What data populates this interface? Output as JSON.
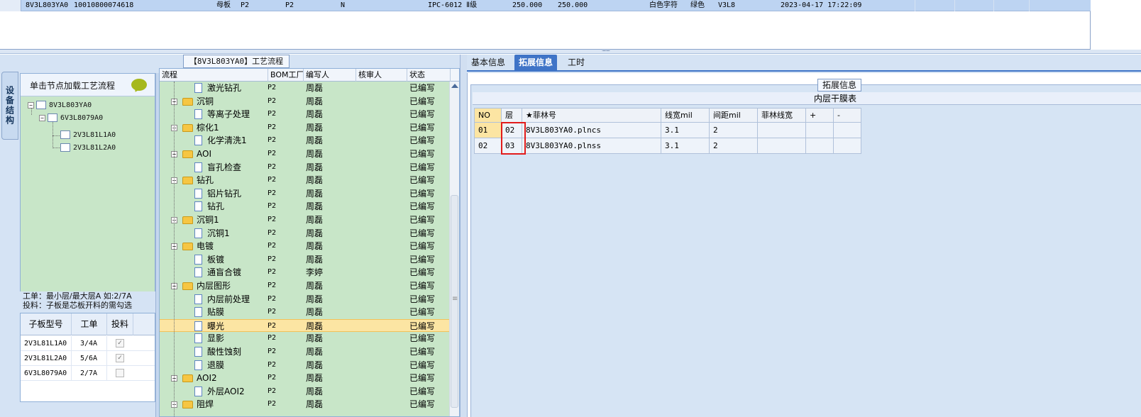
{
  "top_grid": {
    "row": {
      "code": "8V3L803YA0",
      "number": "10010800074618",
      "type": "母板",
      "f1": "P2",
      "f2": "P2",
      "f3": "N",
      "model": "IPC-6012 Ⅱ级",
      "v1": "250.000",
      "v2": "250.000",
      "text_color": "白色字符",
      "solder_color": "绿色",
      "version": "V3L8",
      "datetime": "2023-04-17 17:22:09"
    }
  },
  "splitter_grip": "·········",
  "left": {
    "title": "【8V3L803YA0】工艺流程",
    "side_tab": "设备结构",
    "load_label": "单击节点加载工艺流程",
    "tree": {
      "root": "8V3L803YA0",
      "child": "6V3L8079A0",
      "leaves": [
        "2V3L81L1A0",
        "2V3L81L2A0"
      ]
    },
    "info_line1": "工单：最小层/最大层A 如:2/7A",
    "info_line2": "投料：子板是芯板开料的需勾选",
    "sub_table": {
      "headers": [
        "子板型号",
        "工单",
        "投料"
      ],
      "rows": [
        {
          "model": "2V3L81L1A0",
          "order": "3/4A",
          "checked": true
        },
        {
          "model": "2V3L81L2A0",
          "order": "5/6A",
          "checked": true
        },
        {
          "model": "6V3L8079A0",
          "order": "2/7A",
          "checked": false
        }
      ]
    }
  },
  "flow": {
    "headers": [
      "流程",
      "BOM工厂",
      "编写人",
      "核审人",
      "状态"
    ],
    "rows": [
      {
        "name": "激光钻孔",
        "level": 2,
        "bom": "P2",
        "writer": "周磊",
        "reviewer": "",
        "status": "已编写"
      },
      {
        "name": "沉铜",
        "level": 1,
        "bom": "P2",
        "writer": "周磊",
        "reviewer": "",
        "status": "已编写"
      },
      {
        "name": "等离子处理",
        "level": 2,
        "bom": "P2",
        "writer": "周磊",
        "reviewer": "",
        "status": "已编写"
      },
      {
        "name": "棕化1",
        "level": 1,
        "bom": "P2",
        "writer": "周磊",
        "reviewer": "",
        "status": "已编写"
      },
      {
        "name": "化学清洗1",
        "level": 2,
        "bom": "P2",
        "writer": "周磊",
        "reviewer": "",
        "status": "已编写"
      },
      {
        "name": "AOI",
        "level": 1,
        "bom": "P2",
        "writer": "周磊",
        "reviewer": "",
        "status": "已编写"
      },
      {
        "name": "盲孔检查",
        "level": 2,
        "bom": "P2",
        "writer": "周磊",
        "reviewer": "",
        "status": "已编写"
      },
      {
        "name": "钻孔",
        "level": 1,
        "bom": "P2",
        "writer": "周磊",
        "reviewer": "",
        "status": "已编写"
      },
      {
        "name": "铝片钻孔",
        "level": 2,
        "bom": "P2",
        "writer": "周磊",
        "reviewer": "",
        "status": "已编写"
      },
      {
        "name": "钻孔",
        "level": 2,
        "bom": "P2",
        "writer": "周磊",
        "reviewer": "",
        "status": "已编写"
      },
      {
        "name": "沉铜1",
        "level": 1,
        "bom": "P2",
        "writer": "周磊",
        "reviewer": "",
        "status": "已编写"
      },
      {
        "name": "沉铜1",
        "level": 2,
        "bom": "P2",
        "writer": "周磊",
        "reviewer": "",
        "status": "已编写"
      },
      {
        "name": "电镀",
        "level": 1,
        "bom": "P2",
        "writer": "周磊",
        "reviewer": "",
        "status": "已编写"
      },
      {
        "name": "板镀",
        "level": 2,
        "bom": "P2",
        "writer": "周磊",
        "reviewer": "",
        "status": "已编写"
      },
      {
        "name": "通盲合镀",
        "level": 2,
        "bom": "P2",
        "writer": "李婷",
        "reviewer": "",
        "status": "已编写"
      },
      {
        "name": "内层图形",
        "level": 1,
        "bom": "P2",
        "writer": "周磊",
        "reviewer": "",
        "status": "已编写"
      },
      {
        "name": "内层前处理",
        "level": 2,
        "bom": "P2",
        "writer": "周磊",
        "reviewer": "",
        "status": "已编写"
      },
      {
        "name": "贴膜",
        "level": 2,
        "bom": "P2",
        "writer": "周磊",
        "reviewer": "",
        "status": "已编写"
      },
      {
        "name": "曝光",
        "level": 2,
        "bom": "P2",
        "writer": "周磊",
        "reviewer": "",
        "status": "已编写",
        "selected": true
      },
      {
        "name": "显影",
        "level": 2,
        "bom": "P2",
        "writer": "周磊",
        "reviewer": "",
        "status": "已编写"
      },
      {
        "name": "酸性蚀刻",
        "level": 2,
        "bom": "P2",
        "writer": "周磊",
        "reviewer": "",
        "status": "已编写"
      },
      {
        "name": "退膜",
        "level": 2,
        "bom": "P2",
        "writer": "周磊",
        "reviewer": "",
        "status": "已编写"
      },
      {
        "name": "AOI2",
        "level": 1,
        "bom": "P2",
        "writer": "周磊",
        "reviewer": "",
        "status": "已编写"
      },
      {
        "name": "外层AOI2",
        "level": 2,
        "bom": "P2",
        "writer": "周磊",
        "reviewer": "",
        "status": "已编写"
      },
      {
        "name": "阻焊",
        "level": 1,
        "bom": "P2",
        "writer": "周磊",
        "reviewer": "",
        "status": "已编写"
      }
    ]
  },
  "right": {
    "tabs": [
      "基本信息",
      "拓展信息",
      "工时"
    ],
    "active_tab": "拓展信息",
    "fieldset_label": "拓展信息",
    "table_title": "内层干膜表",
    "headers": [
      "NO",
      "层",
      "★菲林号",
      "线宽mil",
      "间距mil",
      "菲林线宽",
      "+",
      "-"
    ],
    "rows": [
      {
        "no": "01",
        "layer": "02",
        "film": "8V3L803YA0.plncs",
        "line_width": "3.1",
        "spacing": "2",
        "film_width": ""
      },
      {
        "no": "02",
        "layer": "03",
        "film": "8V3L803YA0.plnss",
        "line_width": "3.1",
        "spacing": "2",
        "film_width": ""
      }
    ]
  },
  "colors": {
    "tree_bg": "#c8e6c8",
    "selected_row": "#fce5a3",
    "active_tab": "#3f74c7",
    "highlight_border": "#e21b1b"
  }
}
